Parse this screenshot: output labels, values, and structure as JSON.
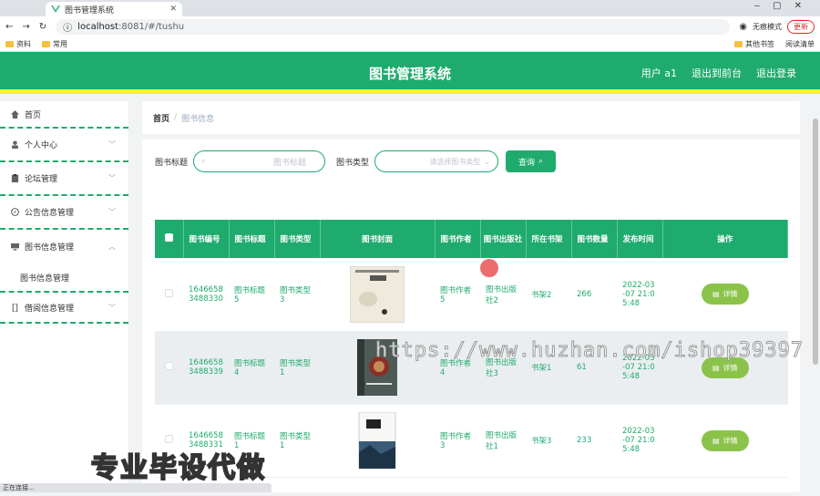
{
  "browser": {
    "tab_title": "图书管理系统",
    "url_host": "localhost",
    "url_port_path": ":8081/#/tushu",
    "incognito_label": "无痕模式",
    "update_label": "更新",
    "bookmarks": [
      "资料",
      "常用"
    ],
    "bookmarks_right": [
      "其他书签",
      "阅读清单"
    ],
    "status_text": "正在连接..."
  },
  "header": {
    "title": "图书管理系统",
    "nav": [
      "用户 a1",
      "退出到前台",
      "退出登录"
    ]
  },
  "sidebar": {
    "items": [
      {
        "label": "首页",
        "icon": "home-icon"
      },
      {
        "label": "个人中心",
        "icon": "user-icon"
      },
      {
        "label": "论坛管理",
        "icon": "clipboard-icon"
      },
      {
        "label": "公告信息管理",
        "icon": "compass-icon"
      },
      {
        "label": "图书信息管理",
        "icon": "monitor-icon"
      },
      {
        "label": "借阅信息管理",
        "icon": "phone-icon"
      }
    ],
    "sub_item": "图书信息管理"
  },
  "breadcrumb": {
    "home": "首页",
    "sep": "/",
    "current": "图书信息"
  },
  "search": {
    "title_label": "图书标题",
    "title_placeholder": "图书标题",
    "type_label": "图书类型",
    "type_placeholder": "请选择图书类型",
    "query_button": "查询"
  },
  "table": {
    "headers": [
      "图书编号",
      "图书标题",
      "图书类型",
      "图书封面",
      "图书作者",
      "图书出版社",
      "所在书架",
      "图书数量",
      "发布时间",
      "操作"
    ],
    "rows": [
      {
        "id": "1646658\n3488330",
        "title": "图书标题\n5",
        "type": "图书类型\n3",
        "author": "图书作者\n5",
        "publisher": "图书出版\n社2",
        "shelf": "书架2",
        "count": "266",
        "time": "2022-03\n-07 21:0\n5:48",
        "action": "详情"
      },
      {
        "id": "1646658\n3488339",
        "title": "图书标题\n4",
        "type": "图书类型\n1",
        "author": "图书作者\n4",
        "publisher": "图书出版\n社3",
        "shelf": "书架1",
        "count": "61",
        "time": "2022-03\n-07 21:0\n5:48",
        "action": "详情"
      },
      {
        "id": "1646658\n3488331",
        "title": "图书标题\n1",
        "type": "图书类型\n1",
        "author": "图书作者\n3",
        "publisher": "图书出版\n社1",
        "shelf": "书架3",
        "count": "233",
        "time": "2022-03\n-07 21:0\n5:48",
        "action": "详情"
      }
    ]
  },
  "overlay": {
    "watermark": "https://www.huzhan.com/ishop39397",
    "promo": "专业毕设代做"
  },
  "colors": {
    "primary": "#1fab6e",
    "accent_bar": "#f7f13b",
    "detail_button": "#8bc34a"
  }
}
